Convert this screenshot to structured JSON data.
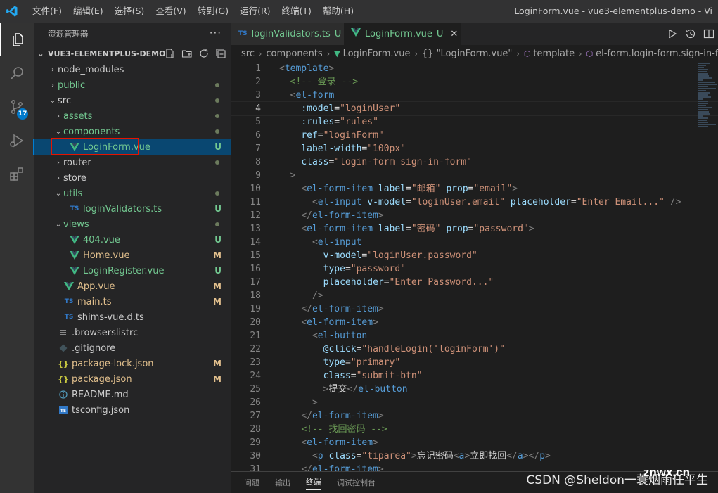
{
  "titlebar": {
    "menus": [
      "文件(F)",
      "编辑(E)",
      "选择(S)",
      "查看(V)",
      "转到(G)",
      "运行(R)",
      "终端(T)",
      "帮助(H)"
    ],
    "title": "LoginForm.vue - vue3-elementplus-demo - Vi"
  },
  "activitybar": {
    "items": [
      "files-icon",
      "search-icon",
      "source-control-icon",
      "run-debug-icon",
      "extensions-icon"
    ],
    "scm_badge": "17"
  },
  "sidebar": {
    "header": "资源管理器",
    "more": "···",
    "project": "VUE3-ELEMENTPLUS-DEMO",
    "tree": [
      {
        "label": "node_modules",
        "kind": "folder",
        "open": false,
        "depth": 0,
        "status": "",
        "dot": false,
        "color": "#cccccc"
      },
      {
        "label": "public",
        "kind": "folder",
        "open": false,
        "depth": 0,
        "status": "",
        "dot": true,
        "color": "#73c991"
      },
      {
        "label": "src",
        "kind": "folder",
        "open": true,
        "depth": 0,
        "status": "",
        "dot": true,
        "color": "#cccccc"
      },
      {
        "label": "assets",
        "kind": "folder",
        "open": false,
        "depth": 1,
        "status": "",
        "dot": true,
        "color": "#73c991"
      },
      {
        "label": "components",
        "kind": "folder",
        "open": true,
        "depth": 1,
        "status": "",
        "dot": true,
        "color": "#73c991"
      },
      {
        "label": "LoginForm.vue",
        "kind": "vue",
        "depth": 2,
        "status": "U",
        "dot": false,
        "color": "#73c991",
        "selected": true
      },
      {
        "label": "router",
        "kind": "folder",
        "open": false,
        "depth": 1,
        "status": "",
        "dot": true,
        "color": "#cccccc"
      },
      {
        "label": "store",
        "kind": "folder",
        "open": false,
        "depth": 1,
        "status": "",
        "dot": false,
        "color": "#cccccc"
      },
      {
        "label": "utils",
        "kind": "folder",
        "open": true,
        "depth": 1,
        "status": "",
        "dot": true,
        "color": "#73c991"
      },
      {
        "label": "loginValidators.ts",
        "kind": "ts",
        "depth": 2,
        "status": "U",
        "dot": false,
        "color": "#73c991"
      },
      {
        "label": "views",
        "kind": "folder",
        "open": true,
        "depth": 1,
        "status": "",
        "dot": true,
        "color": "#73c991"
      },
      {
        "label": "404.vue",
        "kind": "vue",
        "depth": 2,
        "status": "U",
        "dot": false,
        "color": "#73c991"
      },
      {
        "label": "Home.vue",
        "kind": "vue",
        "depth": 2,
        "status": "M",
        "dot": false,
        "color": "#e2c08d"
      },
      {
        "label": "LoginRegister.vue",
        "kind": "vue",
        "depth": 2,
        "status": "U",
        "dot": false,
        "color": "#73c991"
      },
      {
        "label": "App.vue",
        "kind": "vue",
        "depth": 1,
        "status": "M",
        "dot": false,
        "color": "#e2c08d"
      },
      {
        "label": "main.ts",
        "kind": "ts",
        "depth": 1,
        "status": "M",
        "dot": false,
        "color": "#e2c08d"
      },
      {
        "label": "shims-vue.d.ts",
        "kind": "ts",
        "depth": 1,
        "status": "",
        "dot": false,
        "color": "#cccccc"
      },
      {
        "label": ".browserslistrc",
        "kind": "lines",
        "depth": 0,
        "status": "",
        "dot": false,
        "color": "#cccccc"
      },
      {
        "label": ".gitignore",
        "kind": "git",
        "depth": 0,
        "status": "",
        "dot": false,
        "color": "#cccccc"
      },
      {
        "label": "package-lock.json",
        "kind": "json",
        "depth": 0,
        "status": "M",
        "dot": false,
        "color": "#e2c08d"
      },
      {
        "label": "package.json",
        "kind": "json",
        "depth": 0,
        "status": "M",
        "dot": false,
        "color": "#e2c08d"
      },
      {
        "label": "README.md",
        "kind": "info",
        "depth": 0,
        "status": "",
        "dot": false,
        "color": "#cccccc"
      },
      {
        "label": "tsconfig.json",
        "kind": "tsconfig",
        "depth": 0,
        "status": "",
        "dot": false,
        "color": "#cccccc"
      }
    ]
  },
  "editor": {
    "tabs": [
      {
        "label": "loginValidators.ts",
        "badge": "TS",
        "status": "U",
        "active": false
      },
      {
        "label": "LoginForm.vue",
        "badge": "V",
        "status": "U",
        "active": true
      }
    ],
    "breadcrumb": [
      "src",
      "components",
      "LoginForm.vue",
      "{} \"LoginForm.vue\"",
      "template",
      "el-form.login-form.sign-in-form"
    ],
    "current_line": 4,
    "lines": [
      [
        [
          "t-pun",
          "<"
        ],
        [
          "t-tag",
          "template"
        ],
        [
          "t-pun",
          ">"
        ]
      ],
      [
        [
          "t-txt",
          "  "
        ],
        [
          "t-cmt",
          "<!-- 登录 -->"
        ]
      ],
      [
        [
          "t-txt",
          "  "
        ],
        [
          "t-pun",
          "<"
        ],
        [
          "t-tag",
          "el-form"
        ]
      ],
      [
        [
          "t-txt",
          "    "
        ],
        [
          "t-attr",
          ":model"
        ],
        [
          "t-txt",
          "="
        ],
        [
          "t-str",
          "\"loginUser\""
        ]
      ],
      [
        [
          "t-txt",
          "    "
        ],
        [
          "t-attr",
          ":rules"
        ],
        [
          "t-txt",
          "="
        ],
        [
          "t-str",
          "\"rules\""
        ]
      ],
      [
        [
          "t-txt",
          "    "
        ],
        [
          "t-attr",
          "ref"
        ],
        [
          "t-txt",
          "="
        ],
        [
          "t-str",
          "\"loginForm\""
        ]
      ],
      [
        [
          "t-txt",
          "    "
        ],
        [
          "t-attr",
          "label-width"
        ],
        [
          "t-txt",
          "="
        ],
        [
          "t-str",
          "\"100px\""
        ]
      ],
      [
        [
          "t-txt",
          "    "
        ],
        [
          "t-attr",
          "class"
        ],
        [
          "t-txt",
          "="
        ],
        [
          "t-str",
          "\"login-form sign-in-form\""
        ]
      ],
      [
        [
          "t-txt",
          "  "
        ],
        [
          "t-pun",
          ">"
        ]
      ],
      [
        [
          "t-txt",
          "    "
        ],
        [
          "t-pun",
          "<"
        ],
        [
          "t-tag",
          "el-form-item"
        ],
        [
          "t-txt",
          " "
        ],
        [
          "t-attr",
          "label"
        ],
        [
          "t-txt",
          "="
        ],
        [
          "t-str",
          "\"邮箱\""
        ],
        [
          "t-txt",
          " "
        ],
        [
          "t-attr",
          "prop"
        ],
        [
          "t-txt",
          "="
        ],
        [
          "t-str",
          "\"email\""
        ],
        [
          "t-pun",
          ">"
        ]
      ],
      [
        [
          "t-txt",
          "      "
        ],
        [
          "t-pun",
          "<"
        ],
        [
          "t-tag",
          "el-input"
        ],
        [
          "t-txt",
          " "
        ],
        [
          "t-attr",
          "v-model"
        ],
        [
          "t-txt",
          "="
        ],
        [
          "t-str",
          "\"loginUser.email\""
        ],
        [
          "t-txt",
          " "
        ],
        [
          "t-attr",
          "placeholder"
        ],
        [
          "t-txt",
          "="
        ],
        [
          "t-str",
          "\"Enter Email...\""
        ],
        [
          "t-txt",
          " "
        ],
        [
          "t-pun",
          "/>"
        ]
      ],
      [
        [
          "t-txt",
          "    "
        ],
        [
          "t-pun",
          "</"
        ],
        [
          "t-tag",
          "el-form-item"
        ],
        [
          "t-pun",
          ">"
        ]
      ],
      [
        [
          "t-txt",
          "    "
        ],
        [
          "t-pun",
          "<"
        ],
        [
          "t-tag",
          "el-form-item"
        ],
        [
          "t-txt",
          " "
        ],
        [
          "t-attr",
          "label"
        ],
        [
          "t-txt",
          "="
        ],
        [
          "t-str",
          "\"密码\""
        ],
        [
          "t-txt",
          " "
        ],
        [
          "t-attr",
          "prop"
        ],
        [
          "t-txt",
          "="
        ],
        [
          "t-str",
          "\"password\""
        ],
        [
          "t-pun",
          ">"
        ]
      ],
      [
        [
          "t-txt",
          "      "
        ],
        [
          "t-pun",
          "<"
        ],
        [
          "t-tag",
          "el-input"
        ]
      ],
      [
        [
          "t-txt",
          "        "
        ],
        [
          "t-attr",
          "v-model"
        ],
        [
          "t-txt",
          "="
        ],
        [
          "t-str",
          "\"loginUser.password\""
        ]
      ],
      [
        [
          "t-txt",
          "        "
        ],
        [
          "t-attr",
          "type"
        ],
        [
          "t-txt",
          "="
        ],
        [
          "t-str",
          "\"password\""
        ]
      ],
      [
        [
          "t-txt",
          "        "
        ],
        [
          "t-attr",
          "placeholder"
        ],
        [
          "t-txt",
          "="
        ],
        [
          "t-str",
          "\"Enter Password...\""
        ]
      ],
      [
        [
          "t-txt",
          "      "
        ],
        [
          "t-pun",
          "/>"
        ]
      ],
      [
        [
          "t-txt",
          "    "
        ],
        [
          "t-pun",
          "</"
        ],
        [
          "t-tag",
          "el-form-item"
        ],
        [
          "t-pun",
          ">"
        ]
      ],
      [
        [
          "t-txt",
          "    "
        ],
        [
          "t-pun",
          "<"
        ],
        [
          "t-tag",
          "el-form-item"
        ],
        [
          "t-pun",
          ">"
        ]
      ],
      [
        [
          "t-txt",
          "      "
        ],
        [
          "t-pun",
          "<"
        ],
        [
          "t-tag",
          "el-button"
        ]
      ],
      [
        [
          "t-txt",
          "        "
        ],
        [
          "t-attr",
          "@click"
        ],
        [
          "t-txt",
          "="
        ],
        [
          "t-str",
          "\"handleLogin('loginForm')\""
        ]
      ],
      [
        [
          "t-txt",
          "        "
        ],
        [
          "t-attr",
          "type"
        ],
        [
          "t-txt",
          "="
        ],
        [
          "t-str",
          "\"primary\""
        ]
      ],
      [
        [
          "t-txt",
          "        "
        ],
        [
          "t-attr",
          "class"
        ],
        [
          "t-txt",
          "="
        ],
        [
          "t-str",
          "\"submit-btn\""
        ]
      ],
      [
        [
          "t-txt",
          "        "
        ],
        [
          "t-pun",
          ">"
        ],
        [
          "t-txt",
          "提交"
        ],
        [
          "t-pun",
          "</"
        ],
        [
          "t-tag",
          "el-button"
        ]
      ],
      [
        [
          "t-txt",
          "      "
        ],
        [
          "t-pun",
          ">"
        ]
      ],
      [
        [
          "t-txt",
          "    "
        ],
        [
          "t-pun",
          "</"
        ],
        [
          "t-tag",
          "el-form-item"
        ],
        [
          "t-pun",
          ">"
        ]
      ],
      [
        [
          "t-txt",
          "    "
        ],
        [
          "t-cmt",
          "<!-- 找回密码 -->"
        ]
      ],
      [
        [
          "t-txt",
          "    "
        ],
        [
          "t-pun",
          "<"
        ],
        [
          "t-tag",
          "el-form-item"
        ],
        [
          "t-pun",
          ">"
        ]
      ],
      [
        [
          "t-txt",
          "      "
        ],
        [
          "t-pun",
          "<"
        ],
        [
          "t-tag",
          "p"
        ],
        [
          "t-txt",
          " "
        ],
        [
          "t-attr",
          "class"
        ],
        [
          "t-txt",
          "="
        ],
        [
          "t-str",
          "\"tiparea\""
        ],
        [
          "t-pun",
          ">"
        ],
        [
          "t-txt",
          "忘记密码"
        ],
        [
          "t-pun",
          "<"
        ],
        [
          "t-tag",
          "a"
        ],
        [
          "t-pun",
          ">"
        ],
        [
          "t-txt",
          "立即找回"
        ],
        [
          "t-pun",
          "</"
        ],
        [
          "t-tag",
          "a"
        ],
        [
          "t-pun",
          "></"
        ],
        [
          "t-tag",
          "p"
        ],
        [
          "t-pun",
          ">"
        ]
      ],
      [
        [
          "t-txt",
          "    "
        ],
        [
          "t-pun",
          "</"
        ],
        [
          "t-tag",
          "el-form-item"
        ],
        [
          "t-pun",
          ">"
        ]
      ]
    ]
  },
  "panel": {
    "tabs": [
      "问题",
      "输出",
      "终端",
      "调试控制台"
    ],
    "active": 2
  },
  "watermark": {
    "text": "CSDN @Sheldon一蓑烟雨任平生",
    "overlay": "znwx.cn"
  },
  "colors": {
    "accent": "#007acc",
    "untracked": "#73c991",
    "modified": "#e2c08d",
    "highlight_box": "#e51400"
  }
}
